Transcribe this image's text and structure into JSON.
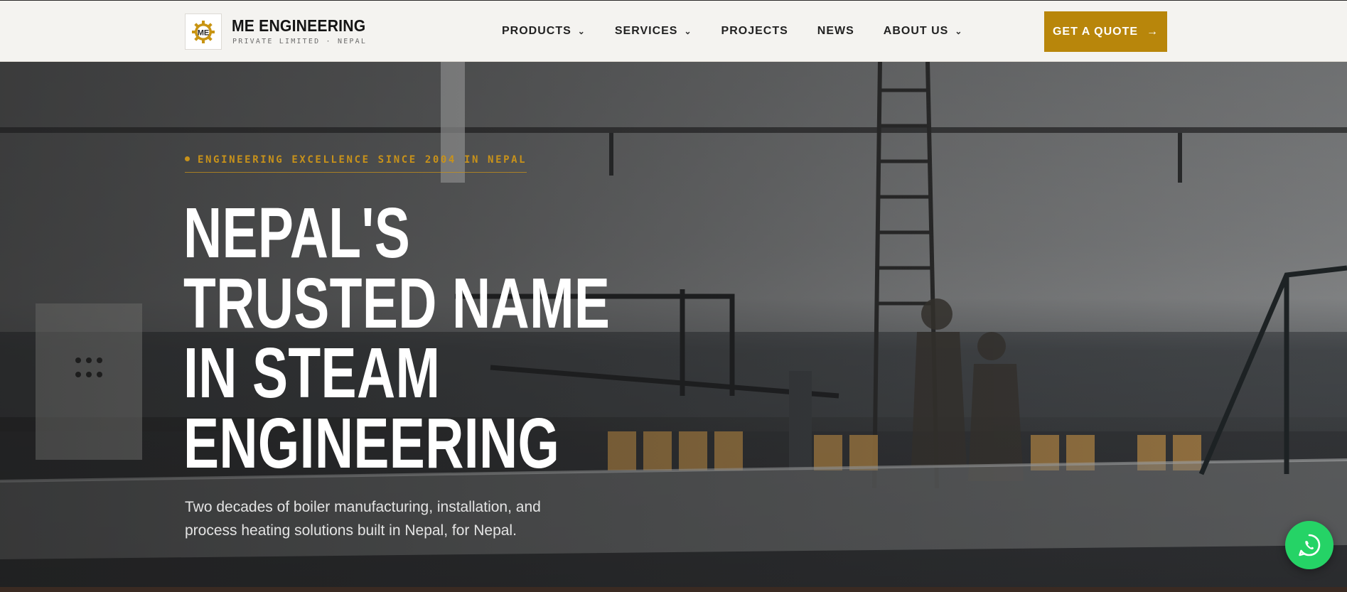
{
  "brand": {
    "name": "ME ENGINEERING",
    "subtitle": "PRIVATE LIMITED · NEPAL",
    "logo_icon": "gear-me-logo-icon",
    "accent_color": "#b8860b"
  },
  "nav": {
    "items": [
      {
        "label": "PRODUCTS",
        "has_dropdown": true
      },
      {
        "label": "SERVICES",
        "has_dropdown": true
      },
      {
        "label": "PROJECTS",
        "has_dropdown": false
      },
      {
        "label": "NEWS",
        "has_dropdown": false
      },
      {
        "label": "ABOUT US",
        "has_dropdown": true
      }
    ],
    "dropdown_icon": "chevron-down-icon"
  },
  "header_cta": {
    "label": "GET A QUOTE",
    "icon": "arrow-right-icon",
    "color": "#b8860b"
  },
  "hero": {
    "eyebrow": "ENGINEERING EXCELLENCE SINCE 2004 IN NEPAL",
    "eyebrow_color": "#c8921a",
    "headline_lines": [
      "NEPAL'S",
      "TRUSTED NAME",
      "IN STEAM",
      "ENGINEERING"
    ],
    "description": "Two decades of boiler manufacturing, installation, and process heating solutions built in Nepal, for Nepal.",
    "background_image": "factory workshop with steam boiler equipment and workers"
  },
  "floating": {
    "whatsapp_icon": "whatsapp-icon",
    "whatsapp_color": "#25d366"
  }
}
